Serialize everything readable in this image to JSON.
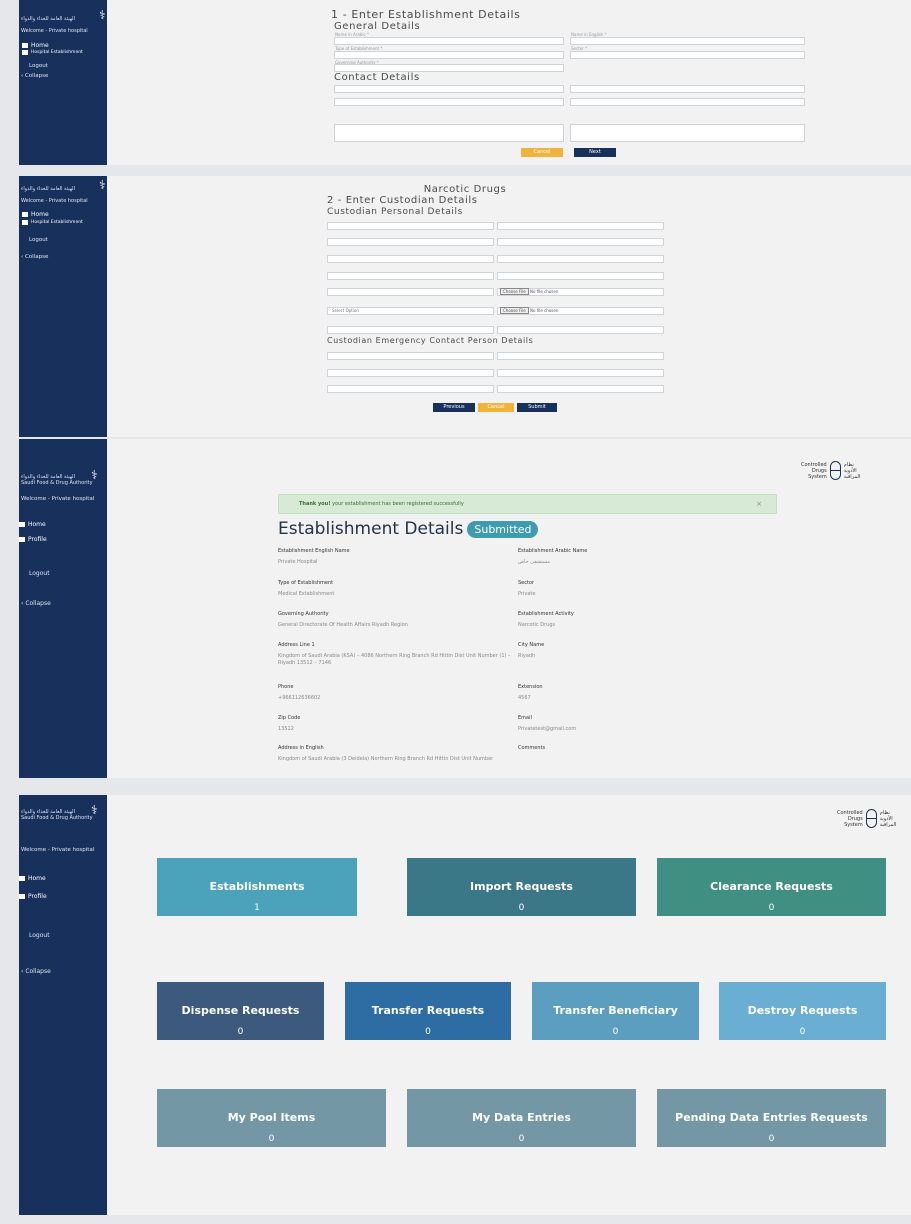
{
  "brand": {
    "authority_ar": "الهيئة العامة للغذاء والدواء",
    "authority_en": "Saudi Food & Drug Authority",
    "welcome": "Welcome - Private hospital",
    "ccd_en": [
      "Controlled",
      "Drugs",
      "System"
    ],
    "ccd_ar": [
      "نظام",
      "الأدوية",
      "المراقبة"
    ]
  },
  "nav": {
    "home": "Home",
    "profile": "Profile",
    "logout": "Logout",
    "collapse": "Collapse",
    "establishment": "Hospital Establishment"
  },
  "step1": {
    "heading": "1 - Enter Establishment Details",
    "general": "General Details",
    "contact": "Contact Details",
    "cancel": "Cancel",
    "next": "Next"
  },
  "step2": {
    "title": "Narcotic Drugs",
    "heading": "2 - Enter Custodian Details",
    "personal": "Custodian Personal Details",
    "emergency": "Custodian Emergency Contact Person Details",
    "choose_file": "Choose File",
    "no_file": "No file chosen",
    "select_option": "Select Option",
    "previous": "Previous",
    "cancel": "Cancel",
    "submit": "Submit"
  },
  "details": {
    "alert_bold": "Thank you!",
    "alert_text": " your establishment has been registered successfully",
    "title": "Establishment Details",
    "badge": "Submitted",
    "fields": [
      {
        "label": "Establishment English Name",
        "value": "Private Hospital"
      },
      {
        "label": "Establishment Arabic Name",
        "value": "مستشفى خاص"
      },
      {
        "label": "Type of Establishment",
        "value": "Medical Establishment"
      },
      {
        "label": "Sector",
        "value": "Private"
      },
      {
        "label": "Governing Authority",
        "value": "General Directorate Of Health Affairs Riyadh Region"
      },
      {
        "label": "Establishment Activity",
        "value": "Narcotic Drugs"
      },
      {
        "label": "Address Line 1",
        "value": "Kingdom of Saudi Arabia (KSA) – 4086 Northern Ring Branch Rd Hittin Dist Unit Number (1) – Riyadh 13512 – 7146"
      },
      {
        "label": "City Name",
        "value": "Riyadh"
      },
      {
        "label": "Phone",
        "value": "+966112636602"
      },
      {
        "label": "Extension",
        "value": "4567"
      },
      {
        "label": "Zip Code",
        "value": "13512"
      },
      {
        "label": "Email",
        "value": "Privatetest@gmail.com"
      },
      {
        "label": "Address in English",
        "value": "Kingdom of Saudi Arabia (3 Deidela) Northern Ring Branch Rd Hittin Dist Unit Number"
      },
      {
        "label": "Comments",
        "value": ""
      }
    ]
  },
  "dashboard": {
    "cards": [
      {
        "title": "Establishments",
        "value": "1",
        "color": "#4aa3ba"
      },
      {
        "title": "Import Requests",
        "value": "0",
        "color": "#3a7787"
      },
      {
        "title": "Clearance Requests",
        "value": "0",
        "color": "#3f8f82"
      },
      {
        "title": "Dispense Requests",
        "value": "0",
        "color": "#3b5a7e"
      },
      {
        "title": "Transfer Requests",
        "value": "0",
        "color": "#2e6da3"
      },
      {
        "title": "Transfer Beneficiary",
        "value": "0",
        "color": "#5b9ec0"
      },
      {
        "title": "Destroy Requests",
        "value": "0",
        "color": "#6aaed3"
      },
      {
        "title": "My Pool Items",
        "value": "0",
        "color": "#7497a6"
      },
      {
        "title": "My Data Entries",
        "value": "0",
        "color": "#7497a6"
      },
      {
        "title": "Pending Data Entries Requests",
        "value": "0",
        "color": "#7497a6"
      }
    ]
  }
}
